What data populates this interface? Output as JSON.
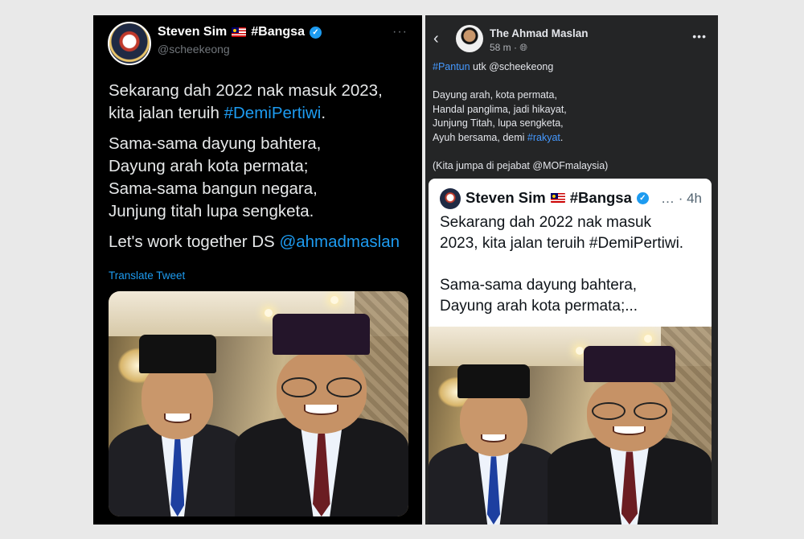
{
  "twitter": {
    "display_name": "Steven Sim",
    "name_tag": "#Bangsa",
    "handle": "@scheekeong",
    "more": "···",
    "line1": "Sekarang dah 2022 nak masuk 2023,",
    "line2_prefix": "kita jalan teruih ",
    "line2_hashtag": "#DemiPertiwi",
    "line2_suffix": ".",
    "pantun": [
      "Sama-sama dayung bahtera,",
      "Dayung arah kota permata;",
      "Sama-sama bangun negara,",
      "Junjung titah lupa sengketa."
    ],
    "closing_prefix": "Let's work together DS ",
    "closing_mention": "@ahmadmaslan",
    "translate": "Translate Tweet"
  },
  "facebook": {
    "back": "‹",
    "author": "The Ahmad Maslan",
    "time": "58 m · ",
    "privacy_icon": "globe-icon",
    "more": "•••",
    "hashtag": "#Pantun",
    "intro": " utk @scheekeong",
    "pantun": [
      "Dayung arah, kota permata,",
      "Handal panglima, jadi hikayat,",
      "Junjung Titah, lupa sengketa,"
    ],
    "last_prefix": "Ayuh bersama, demi ",
    "last_hashtag": "#rakyat",
    "last_suffix": ".",
    "footer": "(Kita jumpa di pejabat @MOFmalaysia)"
  },
  "embedded_tweet": {
    "display_name": "Steven Sim",
    "name_tag": "#Bangsa",
    "time": "… · 4h",
    "line1": "Sekarang dah 2022 nak masuk",
    "line2": "2023, kita jalan teruih #DemiPertiwi.",
    "line3": "Sama-sama dayung bahtera,",
    "line4": "Dayung arah kota permata;..."
  },
  "colors": {
    "twitter_bg": "#000000",
    "twitter_link": "#1d9bf0",
    "facebook_bg": "#242526",
    "facebook_link": "#4599ff",
    "verified": "#1d9bf0"
  }
}
